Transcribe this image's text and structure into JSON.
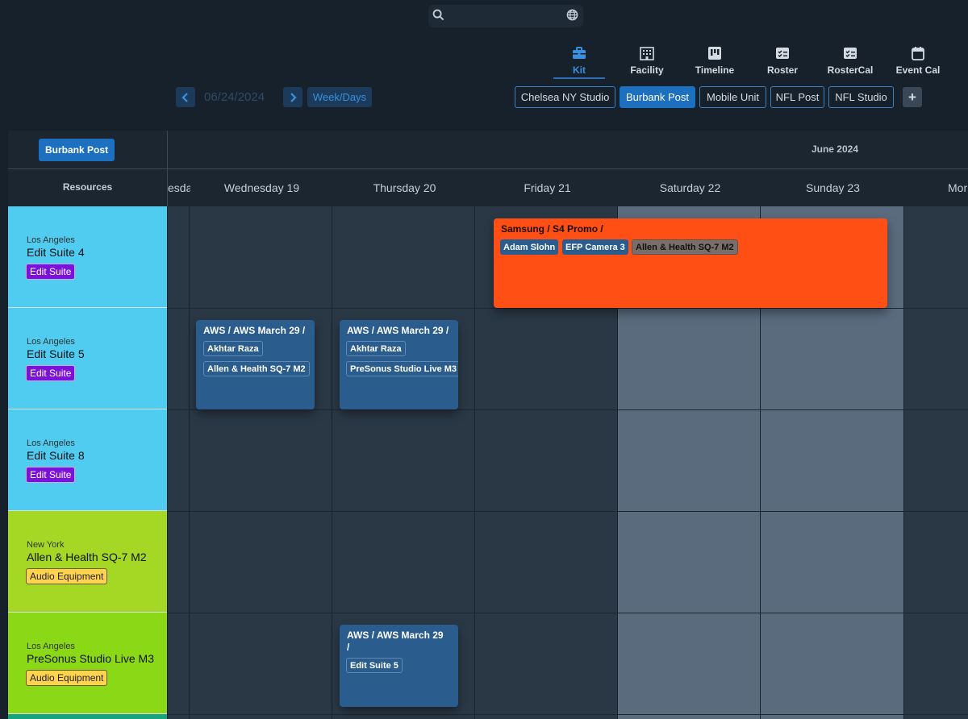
{
  "search": {
    "placeholder": ""
  },
  "nav": [
    {
      "label": "Kit",
      "icon": "toolbox-icon"
    },
    {
      "label": "Facility",
      "icon": "building-icon"
    },
    {
      "label": "Timeline",
      "icon": "timeline-icon"
    },
    {
      "label": "Roster",
      "icon": "roster-icon"
    },
    {
      "label": "RosterCal",
      "icon": "roster-calendar-icon"
    },
    {
      "label": "Event Cal",
      "icon": "calendar-icon"
    }
  ],
  "nav_active": "Kit",
  "date": {
    "value": "06/24/2024",
    "view_label": "Week/Days"
  },
  "studios": [
    "Chelsea NY Studio",
    "Burbank Post",
    "Mobile Unit",
    "NFL Post",
    "NFL Studio"
  ],
  "studio_active": "Burbank Post",
  "calendar": {
    "studio_badge": "Burbank Post",
    "month": "June 2024",
    "resources_header": "Resources",
    "days": [
      "esday",
      "Wednesday 19",
      "Thursday 20",
      "Friday 21",
      "Saturday 22",
      "Sunday 23",
      "Mor"
    ]
  },
  "resources": [
    {
      "location": "Los Angeles",
      "name": "Edit Suite 4",
      "tag": "Edit Suite",
      "color": "#50ccf0"
    },
    {
      "location": "Los Angeles",
      "name": "Edit Suite 5",
      "tag": "Edit Suite",
      "color": "#50ccf0"
    },
    {
      "location": "Los Angeles",
      "name": "Edit Suite 8",
      "tag": "Edit Suite",
      "color": "#50ccf0"
    },
    {
      "location": "New York",
      "name": "Allen & Health SQ-7 M2",
      "tag": "Audio Equipment",
      "color": "#a4d825"
    },
    {
      "location": "Los Angeles",
      "name": "PreSonus Studio Live M3",
      "tag": "Audio Equipment",
      "color": "#8bd817"
    }
  ],
  "events": [
    {
      "title": "Samsung / S4 Promo /",
      "chips": [
        "Adam Slohn",
        "EFP Camera 3",
        "Allen & Health SQ-7 M2"
      ]
    },
    {
      "title": "AWS / AWS March 29 /",
      "chips": [
        "Akhtar Raza",
        "Allen & Health SQ-7 M2"
      ]
    },
    {
      "title": "AWS / AWS March 29 /",
      "chips": [
        "Akhtar Raza",
        "PreSonus Studio Live M3"
      ]
    },
    {
      "title": "AWS / AWS March 29 /",
      "chips": [
        "Edit Suite 5"
      ]
    }
  ],
  "colors": {
    "accent": "#1d6fc0",
    "event_blue": "#2a5c8e",
    "event_orange": "#ff4f14",
    "weekday_col": "#2a3846",
    "weekend_col": "#5a6b7d"
  }
}
